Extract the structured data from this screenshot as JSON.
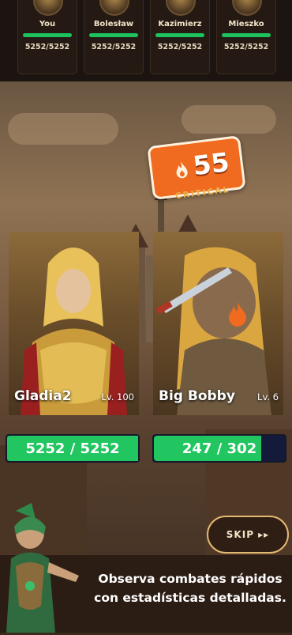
{
  "team": [
    {
      "name": "You",
      "hp": "5252/5252"
    },
    {
      "name": "Bolesław",
      "hp": "5252/5252"
    },
    {
      "name": "Kazimierz",
      "hp": "5252/5252"
    },
    {
      "name": "Mieszko",
      "hp": "5252/5252"
    }
  ],
  "damage": {
    "value": "55",
    "label": "CRITICAL"
  },
  "player": {
    "name": "Gladia2",
    "level": "Lv. 100",
    "hp": "5252 / 5252",
    "hp_fraction": 1.0
  },
  "enemy": {
    "name": "Big Bobby",
    "level": "Lv. 6",
    "hp": "247 / 302",
    "hp_fraction": 0.818
  },
  "controls": {
    "skip": "SKIP ▸▸"
  },
  "promo": {
    "line1": "Observa combates rápidos",
    "line2": "con estadísticas detalladas."
  },
  "colors": {
    "hp_green": "#22c660",
    "damage_orange": "#f06a1f",
    "skip_border": "#e3b873"
  }
}
